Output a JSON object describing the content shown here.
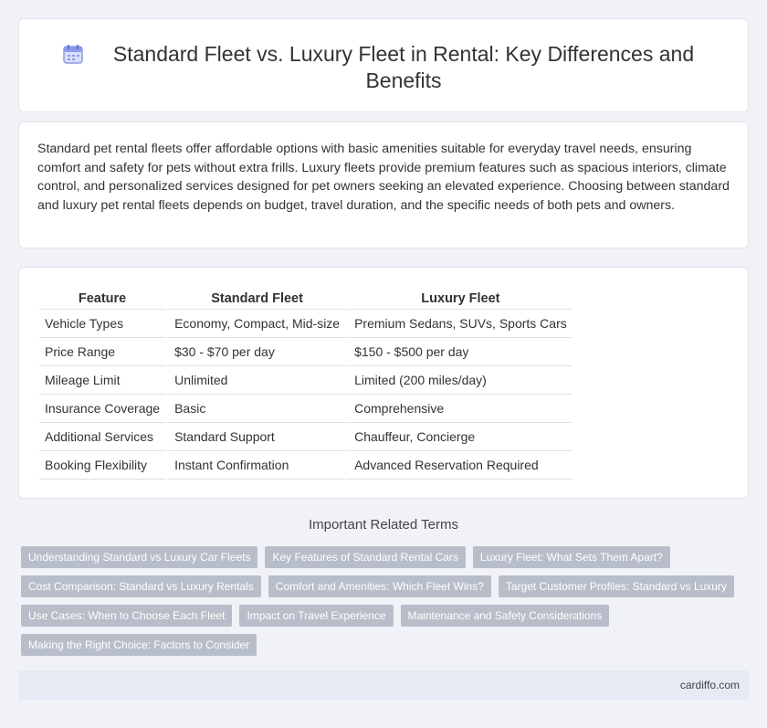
{
  "header": {
    "icon": "calendar-icon",
    "title": "Standard Fleet vs. Luxury Fleet in Rental: Key Differences and Benefits"
  },
  "intro": {
    "text": "Standard pet rental fleets offer affordable options with basic amenities suitable for everyday travel needs, ensuring comfort and safety for pets without extra frills. Luxury fleets provide premium features such as spacious interiors, climate control, and personalized services designed for pet owners seeking an elevated experience. Choosing between standard and luxury pet rental fleets depends on budget, travel duration, and the specific needs of both pets and owners."
  },
  "table": {
    "headers": [
      "Feature",
      "Standard Fleet",
      "Luxury Fleet"
    ],
    "rows": [
      [
        "Vehicle Types",
        "Economy, Compact, Mid-size",
        "Premium Sedans, SUVs, Sports Cars"
      ],
      [
        "Price Range",
        "$30 - $70 per day",
        "$150 - $500 per day"
      ],
      [
        "Mileage Limit",
        "Unlimited",
        "Limited (200 miles/day)"
      ],
      [
        "Insurance Coverage",
        "Basic",
        "Comprehensive"
      ],
      [
        "Additional Services",
        "Standard Support",
        "Chauffeur, Concierge"
      ],
      [
        "Booking Flexibility",
        "Instant Confirmation",
        "Advanced Reservation Required"
      ]
    ]
  },
  "related": {
    "title": "Important Related Terms",
    "tags": [
      "Understanding Standard vs Luxury Car Fleets",
      "Key Features of Standard Rental Cars",
      "Luxury Fleet: What Sets Them Apart?",
      "Cost Comparison: Standard vs Luxury Rentals",
      "Comfort and Amenities: Which Fleet Wins?",
      "Target Customer Profiles: Standard vs Luxury",
      "Use Cases: When to Choose Each Fleet",
      "Impact on Travel Experience",
      "Maintenance and Safety Considerations",
      "Making the Right Choice: Factors to Consider"
    ]
  },
  "footer": {
    "site": "cardiffo.com"
  },
  "colors": {
    "background": "#f0f2f7",
    "tag": "#b8bec9",
    "footer": "#e6eaf5",
    "icon_accent": "#8d9ae6"
  }
}
